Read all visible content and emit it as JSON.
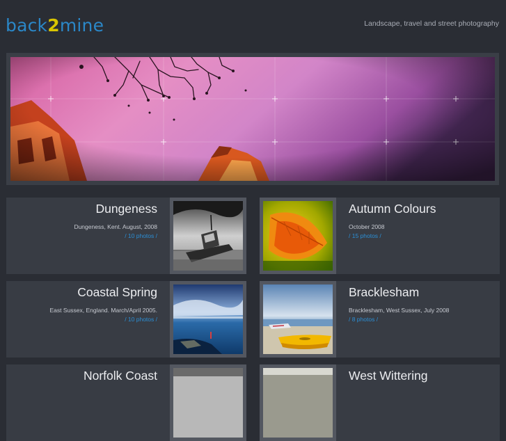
{
  "header": {
    "logo_prefix": "back",
    "logo_mid": "2",
    "logo_suffix": "mine",
    "tagline": "Landscape, travel and street photography"
  },
  "colors": {
    "background": "#2a2d34",
    "panel": "#383c44",
    "logo_blue": "#2b87c7",
    "logo_yellow": "#d9c400",
    "link_blue": "#2b8fd6"
  },
  "galleries": [
    {
      "title": "Dungeness",
      "meta": "Dungeness, Kent. August, 2008",
      "count": "/ 10 photos /"
    },
    {
      "title": "Autumn Colours",
      "meta": "October 2008",
      "count": "/ 15 photos /"
    },
    {
      "title": "Coastal Spring",
      "meta": "East Sussex, England. March/April 2005.",
      "count": "/ 10 photos /"
    },
    {
      "title": "Bracklesham",
      "meta": "Bracklesham, West Sussex, July 2008",
      "count": "/ 8 photos /"
    },
    {
      "title": "Norfolk Coast",
      "meta": "",
      "count": ""
    },
    {
      "title": "West Wittering",
      "meta": "",
      "count": ""
    }
  ]
}
